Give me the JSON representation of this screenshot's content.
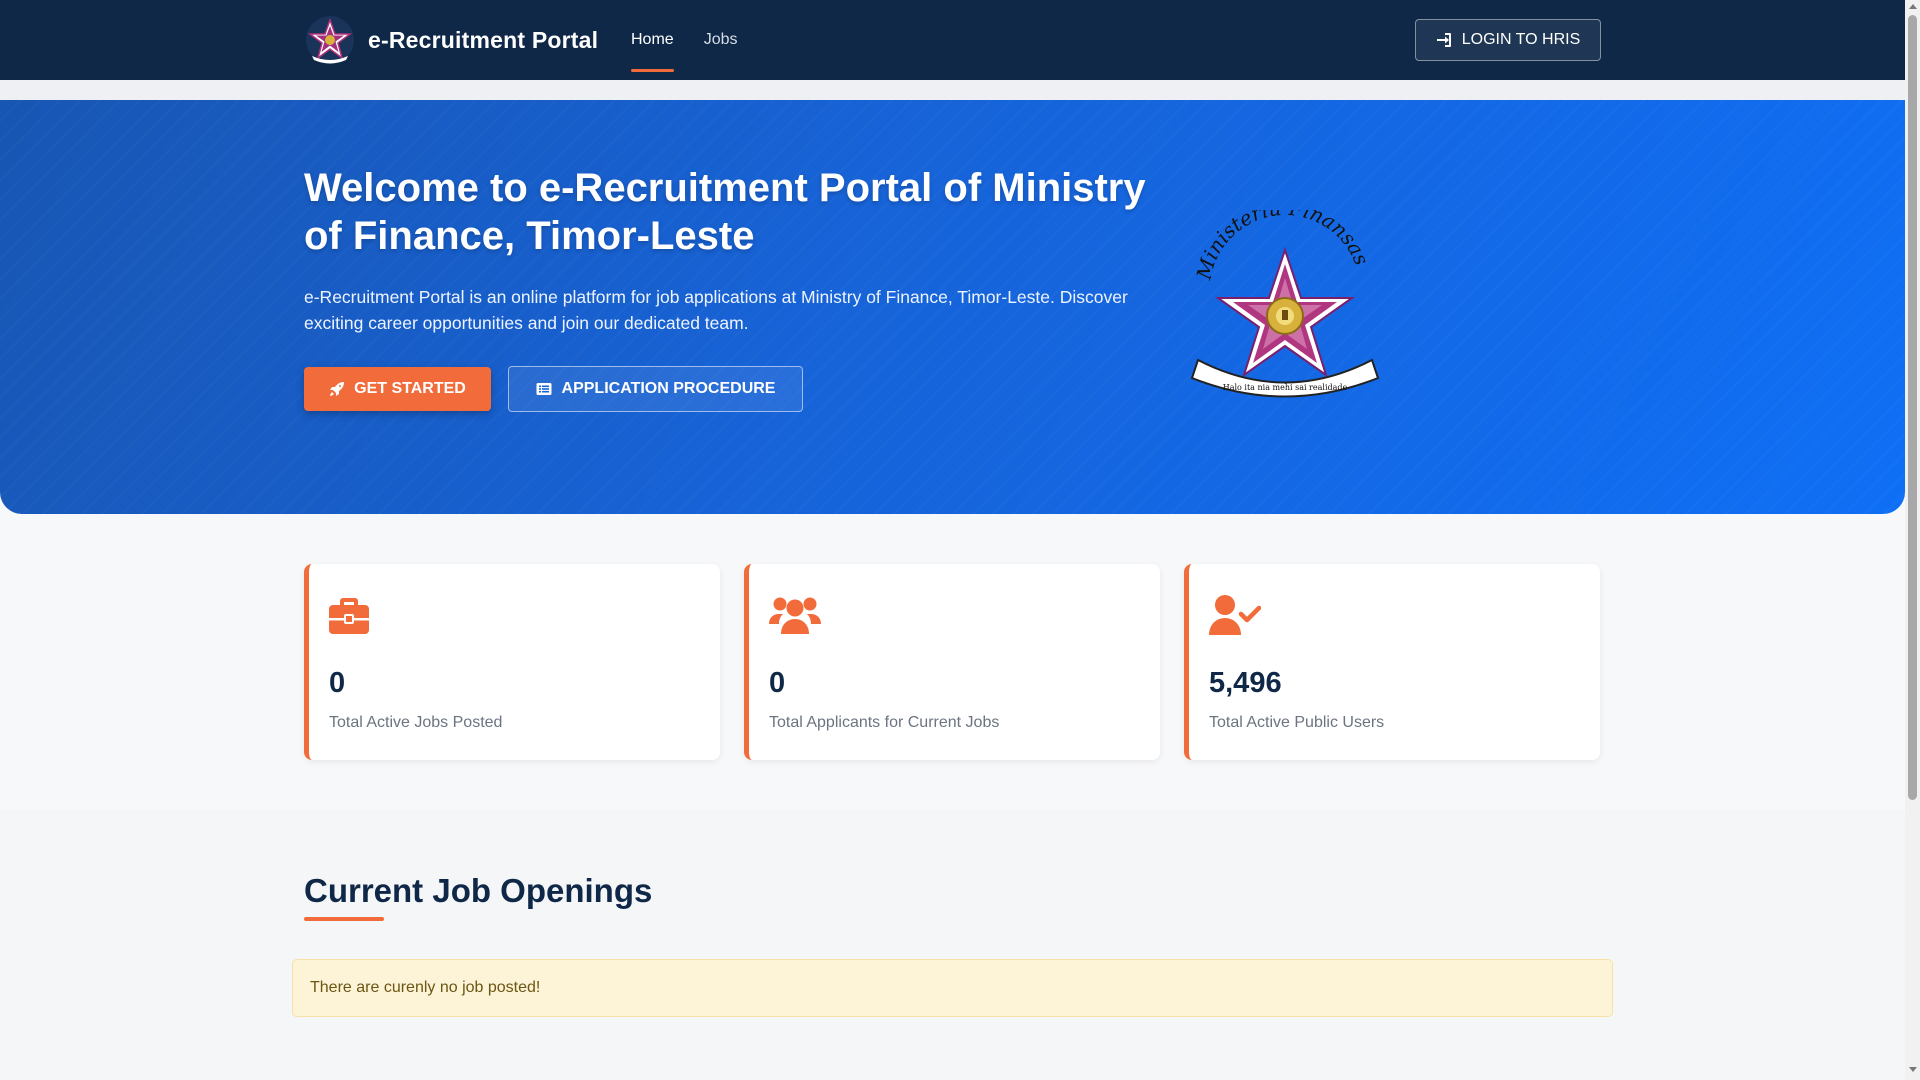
{
  "navbar": {
    "brand": "e-Recruitment Portal",
    "links": [
      {
        "label": "Home",
        "active": true
      },
      {
        "label": "Jobs",
        "active": false
      }
    ],
    "login_label": "LOGIN TO HRIS",
    "login_icon": "sign-in-icon"
  },
  "hero": {
    "title": "Welcome to e-Recruitment Portal of Ministry of Finance, Timor-Leste",
    "description": "e-Recruitment Portal is an online platform for job applications at Ministry of Finance, Timor-Leste. Discover exciting career opportunities and join our dedicated team.",
    "get_started_label": "GET STARTED",
    "get_started_icon": "rocket-icon",
    "procedure_label": "APPLICATION PROCEDURE",
    "procedure_icon": "list-alt-icon",
    "logo": {
      "arc_text": "Ministeriu Finansas",
      "motto": "Halo ita nia mehi sai realidade"
    }
  },
  "stats": [
    {
      "icon": "briefcase-icon",
      "value": "0",
      "label": "Total Active Jobs Posted"
    },
    {
      "icon": "users-icon",
      "value": "0",
      "label": "Total Applicants for Current Jobs"
    },
    {
      "icon": "user-check-icon",
      "value": "5,496",
      "label": "Total Active Public Users"
    }
  ],
  "jobs": {
    "title": "Current Job Openings",
    "empty_message": "There are curenly no job posted!"
  },
  "colors": {
    "navbar": "#0f2847",
    "accent": "#f26b3a",
    "hero_blue": "#1763d8",
    "alert_bg": "#fdf3d7"
  }
}
